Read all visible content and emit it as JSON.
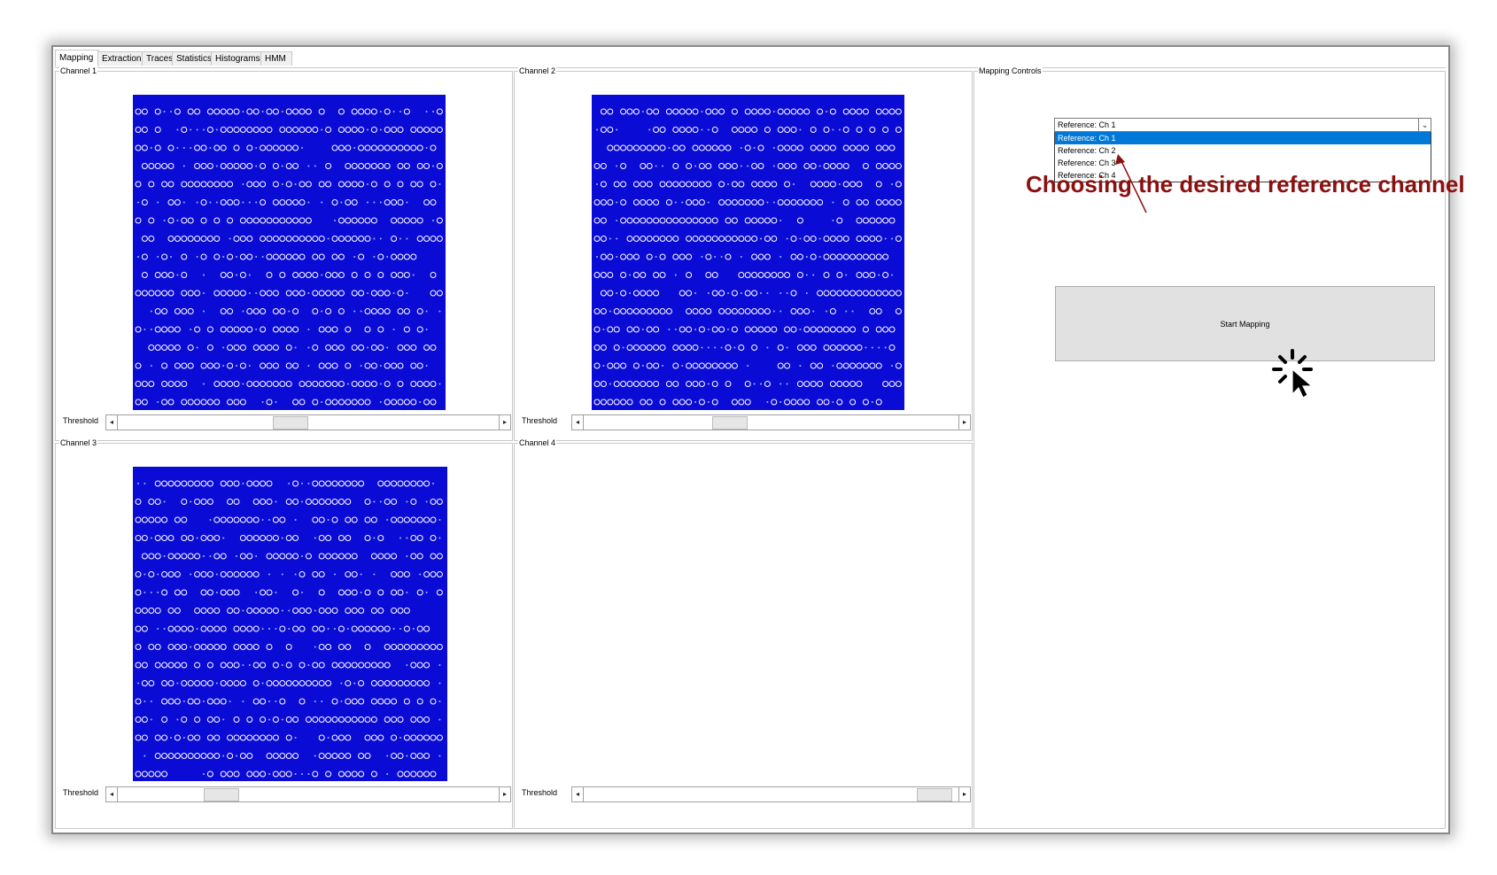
{
  "tabs": [
    "Mapping",
    "Extraction",
    "Traces",
    "Statistics",
    "Histograms",
    "HMM"
  ],
  "active_tab": "Mapping",
  "channels": [
    {
      "title": "Channel 1",
      "threshold_label": "Threshold",
      "threshold_value": 0.45,
      "has_image": true
    },
    {
      "title": "Channel 2",
      "threshold_label": "Threshold",
      "threshold_value": 0.38,
      "has_image": true
    },
    {
      "title": "Channel 3",
      "threshold_label": "Threshold",
      "threshold_value": 0.25,
      "has_image": true
    },
    {
      "title": "Channel 4",
      "threshold_label": "Threshold",
      "threshold_value": 0.98,
      "has_image": false
    }
  ],
  "mapping_controls": {
    "title": "Mapping Controls",
    "reference_selected": "Reference: Ch 1",
    "reference_options": [
      "Reference: Ch 1",
      "Reference: Ch 2",
      "Reference: Ch 3",
      "Reference: Ch 4"
    ],
    "start_button": "Start Mapping"
  },
  "annotation": "Choosing the desired reference channel",
  "colors": {
    "plot_bg": "#0b0bd6",
    "selection": "#0078d7",
    "annotation": "#8b1010"
  }
}
